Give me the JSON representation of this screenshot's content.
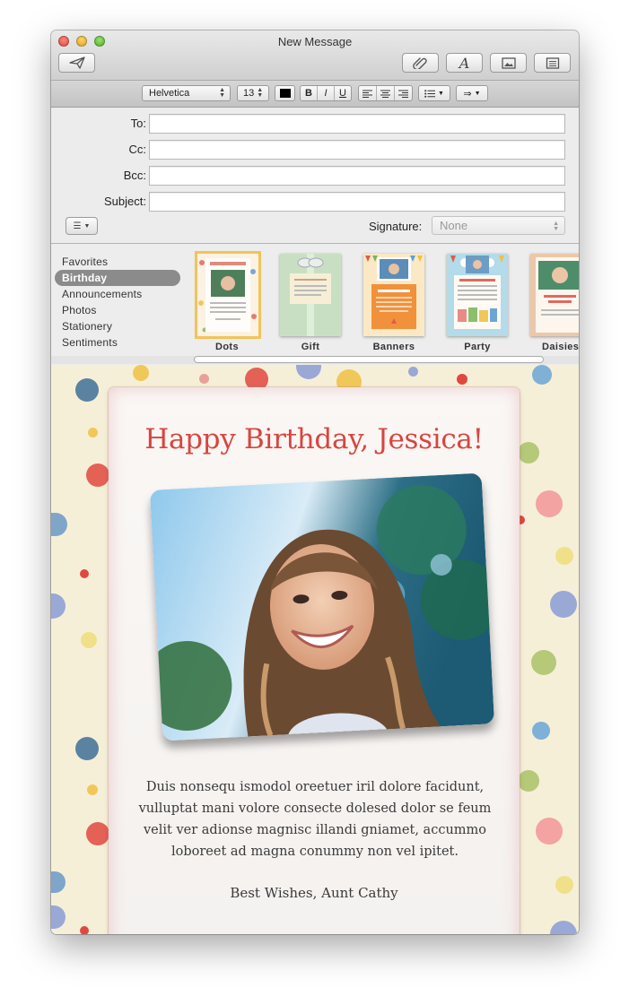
{
  "window": {
    "title": "New Message"
  },
  "format_bar": {
    "font": "Helvetica",
    "size": "13",
    "bold": "B",
    "italic": "I",
    "underline": "U"
  },
  "fields": {
    "to_label": "To:",
    "cc_label": "Cc:",
    "bcc_label": "Bcc:",
    "subject_label": "Subject:",
    "to_value": "",
    "cc_value": "",
    "bcc_value": "",
    "subject_value": "",
    "signature_label": "Signature:",
    "signature_value": "None"
  },
  "stationery": {
    "categories": [
      "Favorites",
      "Birthday",
      "Announcements",
      "Photos",
      "Stationery",
      "Sentiments"
    ],
    "selected_category": "Birthday",
    "templates": [
      "Dots",
      "Gift",
      "Banners",
      "Party",
      "Daisies"
    ],
    "selected_template": "Dots"
  },
  "message": {
    "title": "Happy Birthday, Jessica!",
    "body": "Duis nonsequ ismodol oreetuer iril dolore facidunt, vulluptat mani volore consecte dolesed dolor se feum velit ver adionse magnisc illandi gniamet, accummo loboreet ad magna conummy non vel ipitet.",
    "signature": "Best Wishes, Aunt Cathy"
  },
  "colors": {
    "title_red": "#d8453f",
    "body_background": "#f6efd8",
    "selection_gray": "#8b8b8b"
  },
  "icons": {
    "send": "paper-plane-icon",
    "attach": "paperclip-icon",
    "fonts": "font-letter-icon",
    "photo_browser": "photo-icon",
    "stationery": "stationery-icon"
  }
}
